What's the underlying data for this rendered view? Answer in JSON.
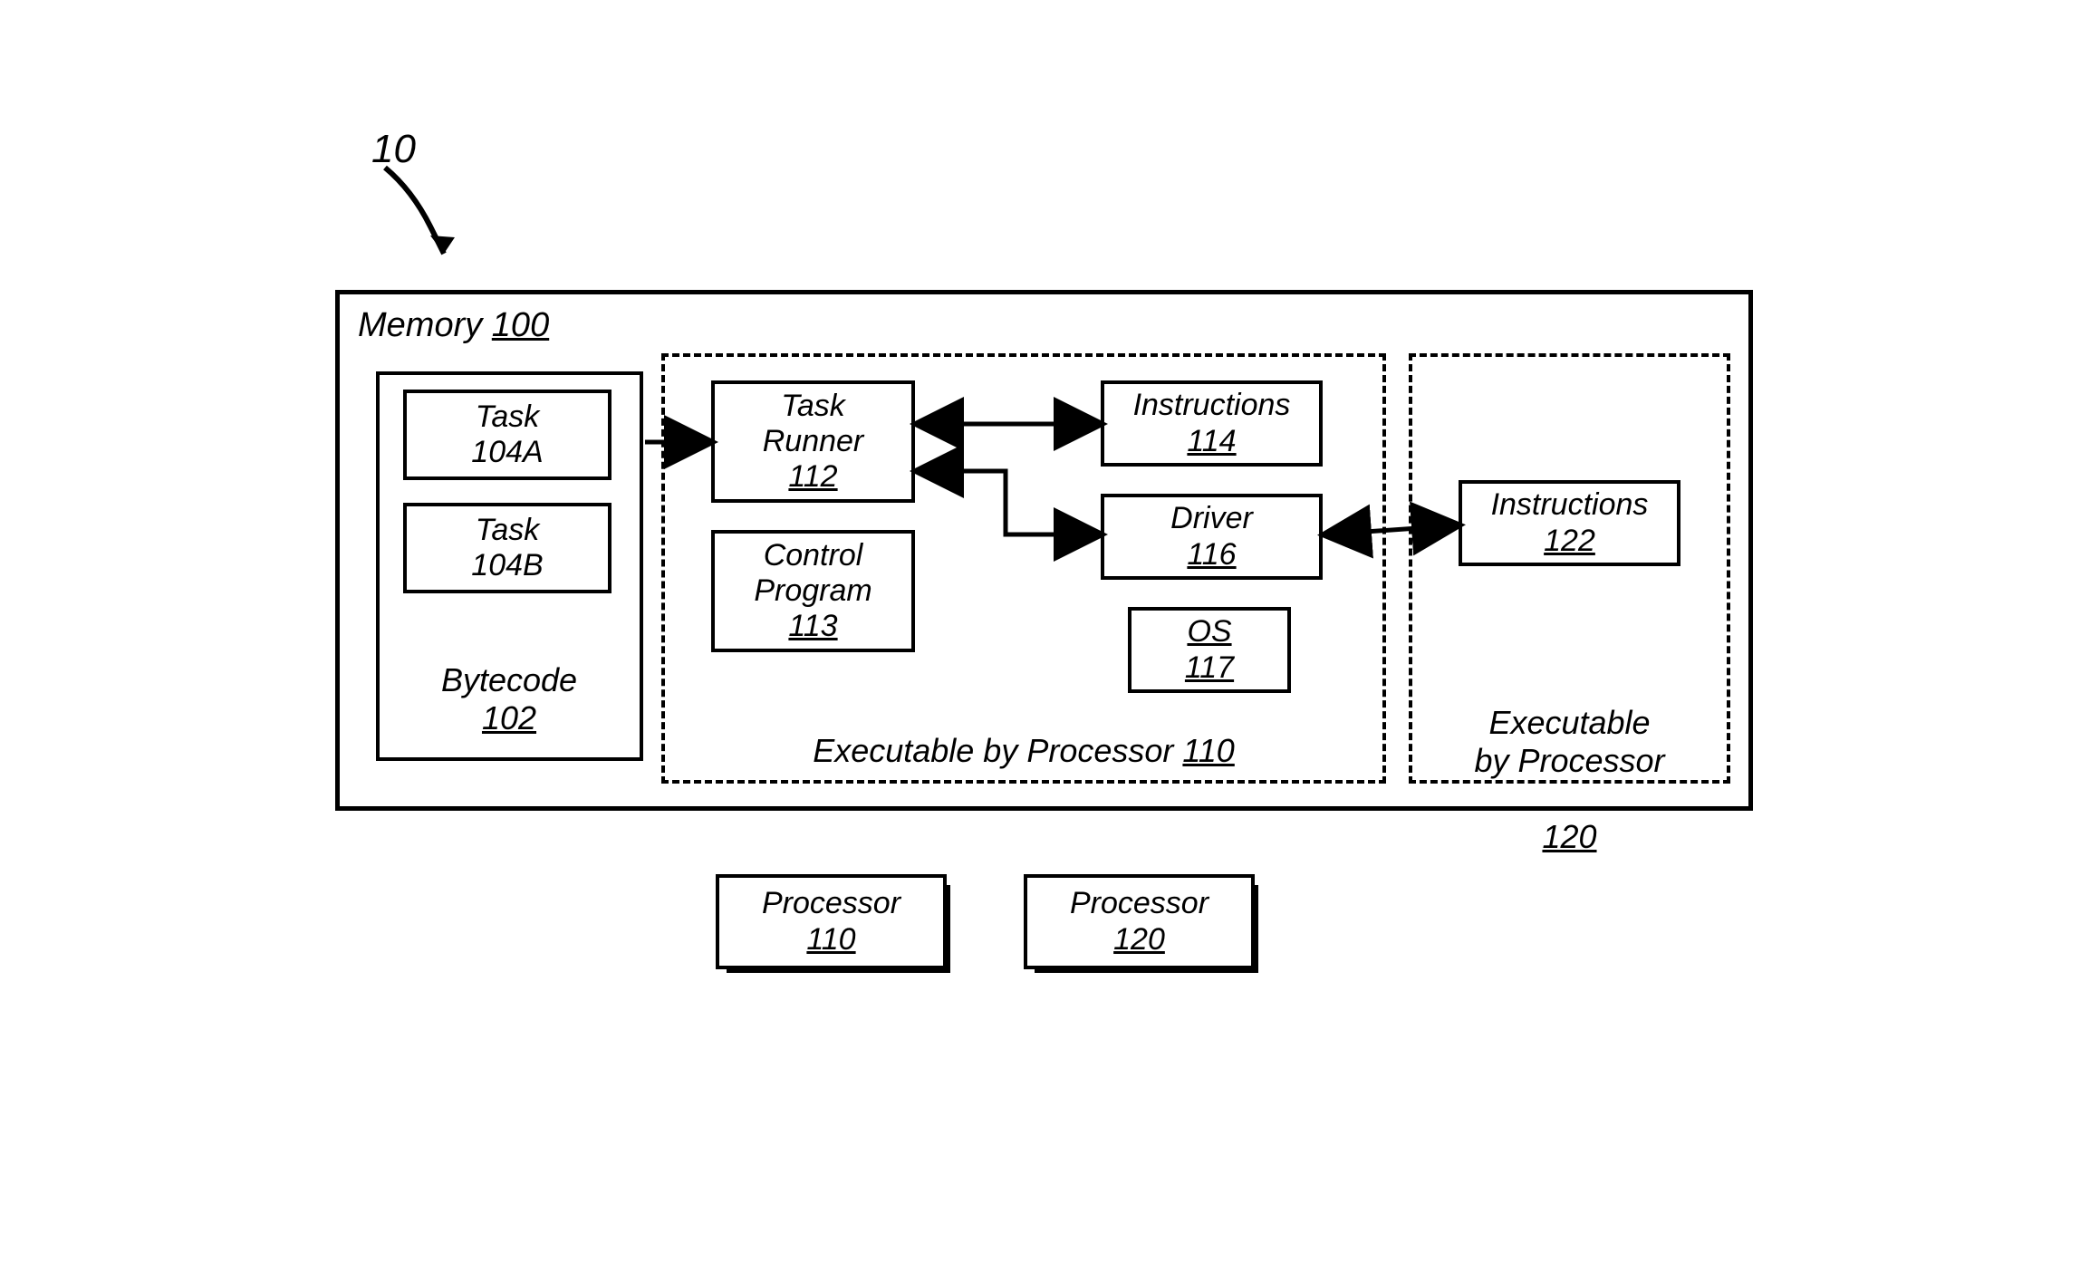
{
  "figure": {
    "number": "10"
  },
  "memory": {
    "label": "Memory",
    "ref": "100"
  },
  "bytecode": {
    "label": "Bytecode",
    "ref": "102",
    "taskA": {
      "label": "Task",
      "ref": "104A"
    },
    "taskB": {
      "label": "Task",
      "ref": "104B"
    }
  },
  "exec1": {
    "caption": "Executable by Processor",
    "ref": "110",
    "taskRunner": {
      "label": "Task\nRunner",
      "ref": "112"
    },
    "instructions": {
      "label": "Instructions",
      "ref": "114"
    },
    "controlProgram": {
      "label": "Control\nProgram",
      "ref": "113"
    },
    "driver": {
      "label": "Driver",
      "ref": "116"
    },
    "os": {
      "label": "OS",
      "ref": "117"
    }
  },
  "exec2": {
    "caption": "Executable\nby Processor",
    "ref": "120",
    "instructions": {
      "label": "Instructions",
      "ref": "122"
    }
  },
  "processors": {
    "p1": {
      "label": "Processor",
      "ref": "110"
    },
    "p2": {
      "label": "Processor",
      "ref": "120"
    }
  }
}
